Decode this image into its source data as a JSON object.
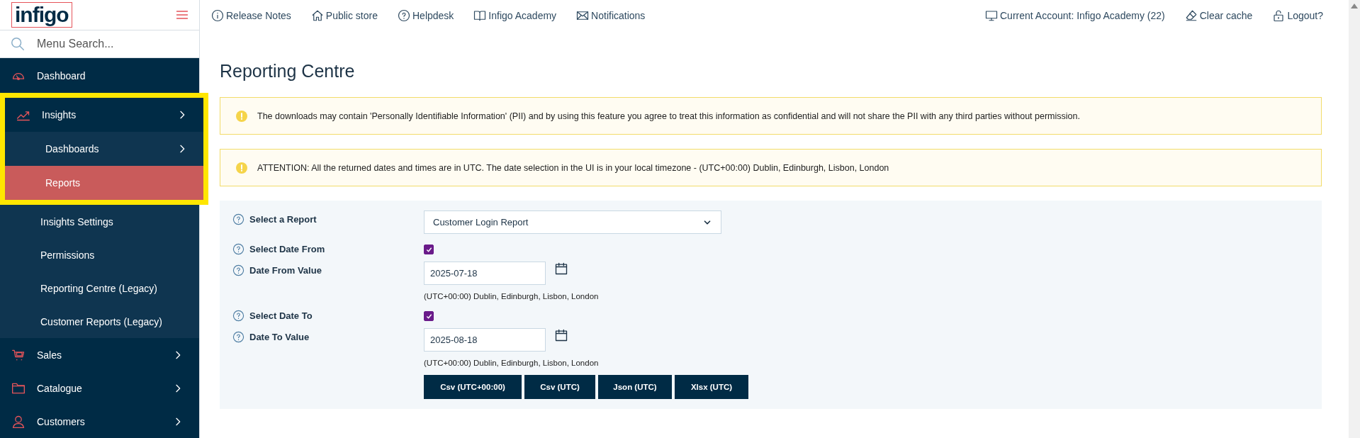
{
  "logo": {
    "text": "infigo"
  },
  "menu_search": {
    "placeholder": "Menu Search..."
  },
  "sidebar": {
    "items": [
      {
        "label": "Dashboard",
        "expandable": false,
        "selected": false,
        "highlighted": false
      },
      {
        "label": "Insights",
        "expandable": true,
        "expanded": true,
        "selected": false,
        "highlighted": true,
        "children": [
          {
            "label": "Dashboards",
            "expandable": true,
            "selected": false,
            "highlighted": true
          },
          {
            "label": "Reports",
            "expandable": false,
            "selected": true,
            "highlighted": true
          },
          {
            "label": "Insights Settings",
            "expandable": false,
            "selected": false,
            "highlighted": false
          },
          {
            "label": "Permissions",
            "expandable": false,
            "selected": false,
            "highlighted": false
          },
          {
            "label": "Reporting Centre (Legacy)",
            "expandable": false,
            "selected": false,
            "highlighted": false
          },
          {
            "label": "Customer Reports (Legacy)",
            "expandable": false,
            "selected": false,
            "highlighted": false
          }
        ]
      },
      {
        "label": "Sales",
        "expandable": true,
        "selected": false,
        "highlighted": false
      },
      {
        "label": "Catalogue",
        "expandable": true,
        "selected": false,
        "highlighted": false
      },
      {
        "label": "Customers",
        "expandable": true,
        "selected": false,
        "highlighted": false
      }
    ]
  },
  "top_links": [
    "Release Notes",
    "Public store",
    "Helpdesk",
    "Infigo Academy",
    "Notifications"
  ],
  "account_links": [
    "Current Account: Infigo Academy (22)",
    "Clear cache",
    "Logout?"
  ],
  "page_title": "Reporting Centre",
  "alerts": [
    "The downloads may contain 'Personally Identifiable Information' (PII) and by using this feature you agree to treat this information as confidential and will not share the PII with any third parties without permission.",
    "ATTENTION: All the returned dates and times are in UTC. The date selection in the UI is in your local timezone - (UTC+00:00) Dublin, Edinburgh, Lisbon, London"
  ],
  "form": {
    "rows": [
      {
        "kind": "select",
        "label": "Select a Report",
        "value": "Customer Login Report"
      },
      {
        "kind": "checkbox",
        "label": "Select Date From",
        "checked": true
      },
      {
        "kind": "date",
        "label": "Date From Value",
        "value": "2025-07-18",
        "hint": "(UTC+00:00) Dublin, Edinburgh, Lisbon, London"
      },
      {
        "kind": "checkbox",
        "label": "Select Date To",
        "checked": true
      },
      {
        "kind": "date",
        "label": "Date To Value",
        "value": "2025-08-18",
        "hint": "(UTC+00:00) Dublin, Edinburgh, Lisbon, London"
      }
    ],
    "buttons": [
      "Csv (UTC+00:00)",
      "Csv (UTC)",
      "Json (UTC)",
      "Xlsx (UTC)"
    ]
  }
}
